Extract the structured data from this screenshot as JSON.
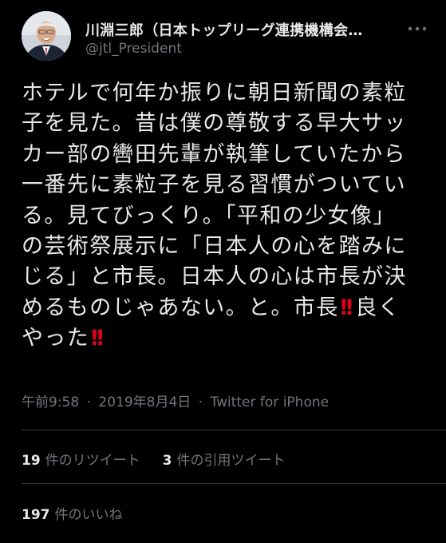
{
  "author": {
    "display_name": "川淵三郎（日本トップリーグ連携機構会…",
    "handle": "@jtl_President",
    "avatar": "profile-photo"
  },
  "tweet": {
    "lines": [
      "ホテルで何年か振りに朝日新聞の素粒",
      "子を見た。昔は僕の尊敬する早大サッ",
      "カー部の轡田先輩が執筆していたから",
      "一番先に素粒子を見る習慣がついてい",
      "る。見てびっくり。「平和の少女像」",
      "の芸術祭展示に「日本人の心を踏みに",
      "じる」と市長。日本人の心は市長が決"
    ],
    "line8_before": "めるものじゃあない。と。市長",
    "line8_emoji": "!!",
    "line8_after": "良く",
    "line9_before": "やった",
    "line9_emoji": "!!"
  },
  "meta": {
    "time": "午前9:58",
    "separator": "·",
    "date": "2019年8月4日",
    "source": "Twitter for iPhone"
  },
  "stats": {
    "retweets_count": "19",
    "retweets_label": "件のリツイート",
    "quotes_count": "3",
    "quotes_label": "件の引用ツイート",
    "likes_count": "197",
    "likes_label": "件のいいね"
  },
  "icons": {
    "more": "more-horizontal-icon",
    "emoji": "double-exclamation-emoji"
  },
  "colors": {
    "background": "#000000",
    "text": "#e7e9ea",
    "secondary": "#71767b",
    "divider": "#2f3336",
    "emoji_red": "#e0001b"
  }
}
